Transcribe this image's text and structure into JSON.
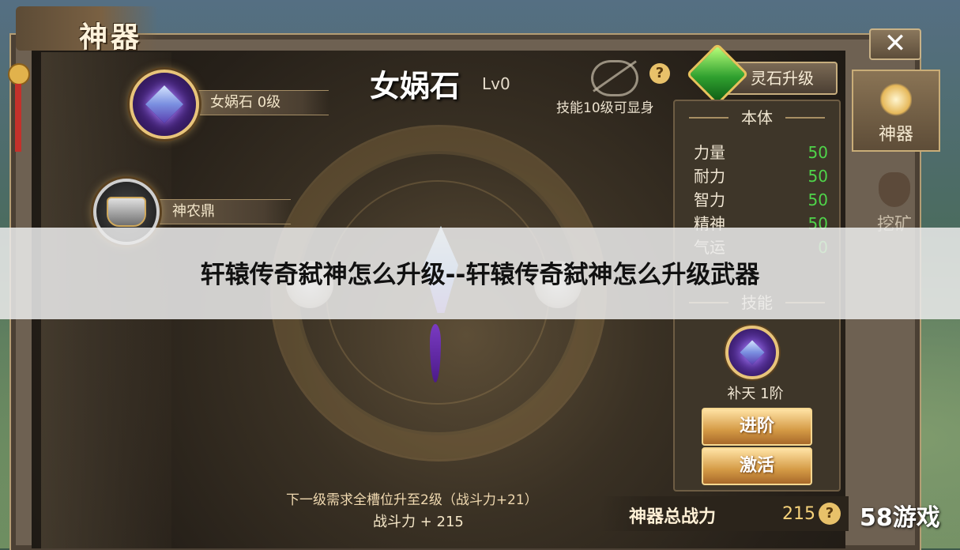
{
  "window": {
    "title": "神器",
    "close_icon": "close-icon"
  },
  "artifact": {
    "name": "女娲石",
    "level": "Lv0",
    "skill_hint": "技能10级可显身"
  },
  "item_list": [
    {
      "label": "女娲石 0级",
      "icon": "crystal-icon"
    },
    {
      "label": "神农鼎",
      "icon": "cauldron-icon"
    }
  ],
  "upgrade": {
    "label": "灵石升级",
    "icon": "green-gem-icon"
  },
  "body_section": {
    "header": "本体",
    "stats": [
      {
        "name": "力量",
        "value": "50"
      },
      {
        "name": "耐力",
        "value": "50"
      },
      {
        "name": "智力",
        "value": "50"
      },
      {
        "name": "精神",
        "value": "50"
      },
      {
        "name": "气运",
        "value": "0"
      }
    ]
  },
  "skill_section": {
    "header": "技能",
    "skill_name": "补天 1阶"
  },
  "actions": {
    "advance": "进阶",
    "activate": "激活"
  },
  "side_tabs": [
    {
      "label": "神器",
      "icon": "artifact-tab-icon",
      "active": true
    },
    {
      "label": "挖矿",
      "icon": "mining-bag-icon",
      "active": false
    }
  ],
  "bottom": {
    "requirement": "下一级需求全槽位升至2级（战斗力+21）",
    "power_bonus": "战斗力 + 215",
    "total_label": "神器总战力",
    "total_value": "215"
  },
  "overlay": {
    "title": "轩辕传奇弑神怎么升级--轩辕传奇弑神怎么升级武器"
  },
  "watermark": "58游戏",
  "colors": {
    "stat_value": "#4fd44a",
    "accent_gold": "#e8c47a",
    "panel_bg": "#3e3629"
  }
}
